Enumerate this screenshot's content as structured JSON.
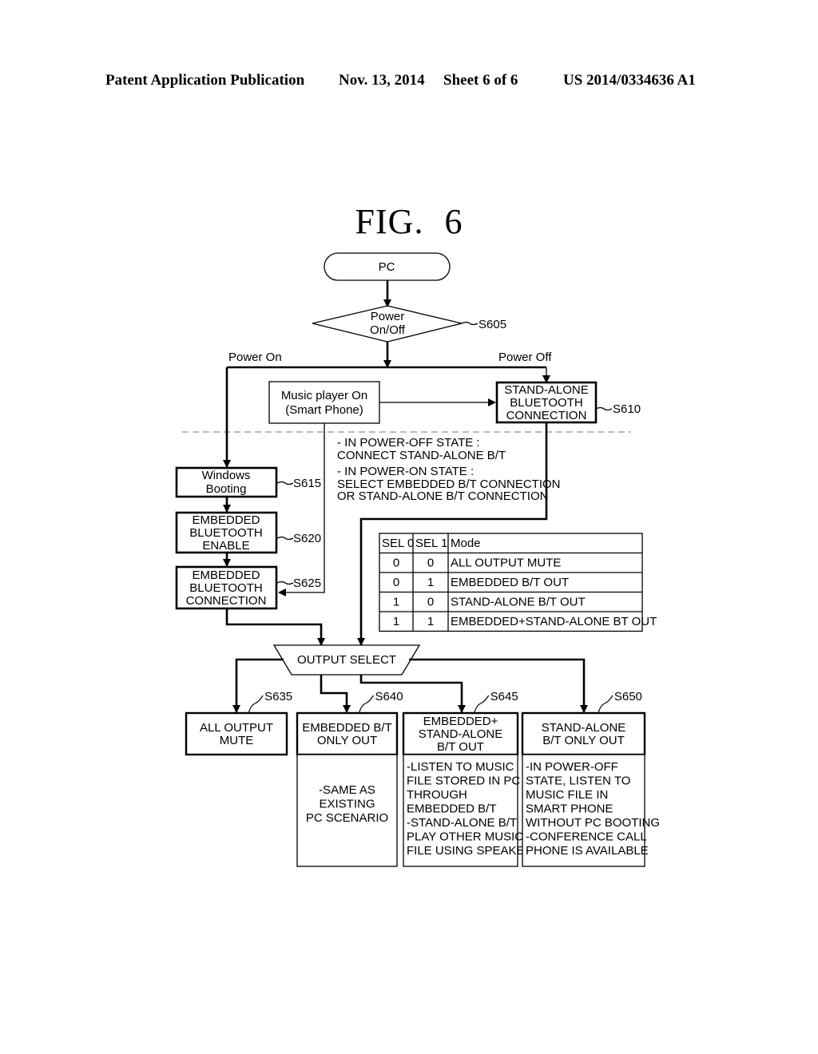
{
  "header": {
    "publication_label": "Patent Application Publication",
    "date": "Nov. 13, 2014",
    "sheet": "Sheet 6 of 6",
    "patent_number": "US 2014/0334636 A1"
  },
  "figure": {
    "title": "FIG.",
    "number": "6"
  },
  "flow": {
    "start": "PC",
    "decision": {
      "line1": "Power",
      "line2": "On/Off",
      "step": "S605"
    },
    "branch_on": "Power On",
    "branch_off": "Power Off",
    "music_player": {
      "line1": "Music player On",
      "line2": "(Smart Phone)"
    },
    "standalone_conn": {
      "line1": "STAND-ALONE",
      "line2": "BLUETOOTH",
      "line3": "CONNECTION",
      "step": "S610"
    },
    "windows_booting": {
      "line1": "Windows",
      "line2": "Booting",
      "step": "S615"
    },
    "embedded_enable": {
      "line1": "EMBEDDED",
      "line2": "BLUETOOTH",
      "line3": "ENABLE",
      "step": "S620"
    },
    "embedded_conn": {
      "line1": "EMBEDDED",
      "line2": "BLUETOOTH",
      "line3": "CONNECTION",
      "step": "S625"
    },
    "note": {
      "line1": "- IN POWER-OFF STATE :",
      "line2": "CONNECT STAND-ALONE B/T",
      "line3": "- IN POWER-ON STATE :",
      "line4": "SELECT EMBEDDED B/T CONNECTION",
      "line5": "OR STAND-ALONE B/T CONNECTION"
    },
    "output_select": "OUTPUT SELECT",
    "outputs": [
      {
        "step": "S635",
        "title1": "ALL OUTPUT",
        "title2": "MUTE",
        "title3": "",
        "desc": []
      },
      {
        "step": "S640",
        "title1": "EMBEDDED B/T",
        "title2": "ONLY OUT",
        "title3": "",
        "desc": [
          "-SAME AS",
          "EXISTING",
          "PC SCENARIO"
        ]
      },
      {
        "step": "S645",
        "title1": "EMBEDDED+",
        "title2": "STAND-ALONE",
        "title3": "B/T OUT",
        "desc": [
          "-LISTEN TO MUSIC",
          "FILE STORED IN PC",
          "THROUGH",
          "EMBEDDED B/T",
          "-STAND-ALONE B/T",
          "PLAY OTHER MUSIC",
          "FILE USING SPEAKER"
        ]
      },
      {
        "step": "S650",
        "title1": "STAND-ALONE",
        "title2": "B/T ONLY OUT",
        "title3": "",
        "desc": [
          "-IN POWER-OFF",
          "STATE, LISTEN TO",
          "MUSIC FILE IN",
          "SMART PHONE",
          "WITHOUT PC BOOTING",
          "-CONFERENCE CALL",
          "PHONE IS AVAILABLE"
        ]
      }
    ]
  },
  "mode_table": {
    "headers": [
      "SEL 0",
      "SEL 1",
      "Mode"
    ],
    "rows": [
      [
        "0",
        "0",
        "ALL OUTPUT MUTE"
      ],
      [
        "0",
        "1",
        "EMBEDDED B/T OUT"
      ],
      [
        "1",
        "0",
        "STAND-ALONE B/T OUT"
      ],
      [
        "1",
        "1",
        "EMBEDDED+STAND-ALONE BT OUT"
      ]
    ]
  }
}
